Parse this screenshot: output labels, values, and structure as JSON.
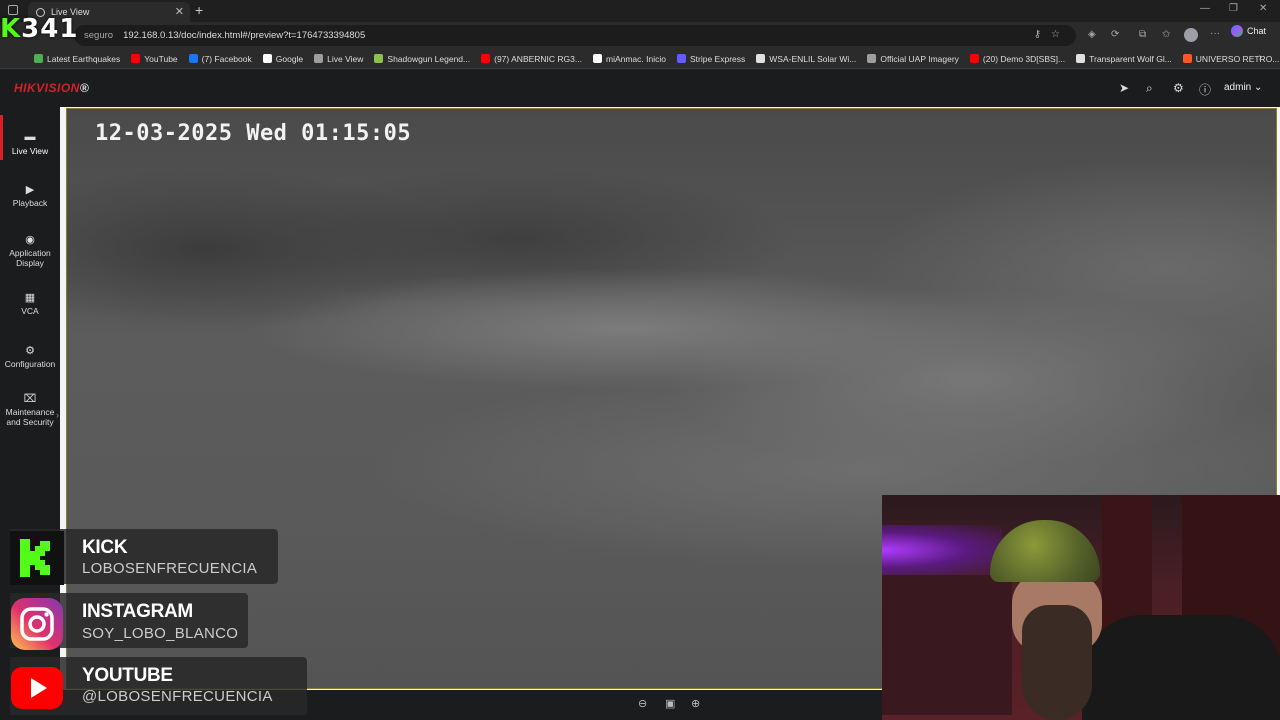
{
  "browser": {
    "tab_title": "Live View",
    "new_tab": "+",
    "url_security": "seguro",
    "url": "192.168.0.13/doc/index.html#/preview?t=1764733394805",
    "chat_label": "Chat",
    "bookmarks": [
      {
        "label": "Latest Earthquakes",
        "color": "#4caf50"
      },
      {
        "label": "YouTube",
        "color": "#ff0000"
      },
      {
        "label": "(7) Facebook",
        "color": "#1877f2"
      },
      {
        "label": "Google",
        "color": "#ffffff"
      },
      {
        "label": "Live View",
        "color": "#9e9e9e"
      },
      {
        "label": "Shadowgun Legend...",
        "color": "#8bc34a"
      },
      {
        "label": "(97) ANBERNIC RG3...",
        "color": "#ff0000"
      },
      {
        "label": "miAnmac. Inicio",
        "color": "#ffffff"
      },
      {
        "label": "Stripe Express",
        "color": "#635bff"
      },
      {
        "label": "WSA-ENLIL Solar Wi...",
        "color": "#e0e0e0"
      },
      {
        "label": "Official UAP Imagery",
        "color": "#9e9e9e"
      },
      {
        "label": "(20) Demo 3D[SBS]...",
        "color": "#ff0000"
      },
      {
        "label": "Transparent Wolf Gl...",
        "color": "#e0e0e0"
      },
      {
        "label": "UNIVERSO RETRO...",
        "color": "#ff5722"
      }
    ]
  },
  "kick_counter": {
    "k": "K",
    "number": "341"
  },
  "hik": {
    "logo_main": "HIKVISION",
    "logo_mark": "®",
    "user": "admin",
    "nav": [
      {
        "label": "Live View",
        "icon": "live-view-icon"
      },
      {
        "label": "Playback",
        "icon": "playback-icon"
      },
      {
        "label": "Application Display",
        "icon": "application-icon"
      },
      {
        "label": "VCA",
        "icon": "vca-icon"
      },
      {
        "label": "Configuration",
        "icon": "gear-icon"
      },
      {
        "label": "Maintenance and Security",
        "icon": "maintenance-icon"
      }
    ],
    "osd": "12-03-2025 Wed 01:15:05"
  },
  "social": [
    {
      "title": "KICK",
      "handle": "LOBOSENFRECUENCIA",
      "color": "#53fc18"
    },
    {
      "title": "INSTAGRAM",
      "handle": "SOY_LOBO_BLANCO",
      "color": "#e1306c"
    },
    {
      "title": "YOUTUBE",
      "handle": "@LOBOSENFRECUENCIA",
      "color": "#ff0000"
    }
  ]
}
